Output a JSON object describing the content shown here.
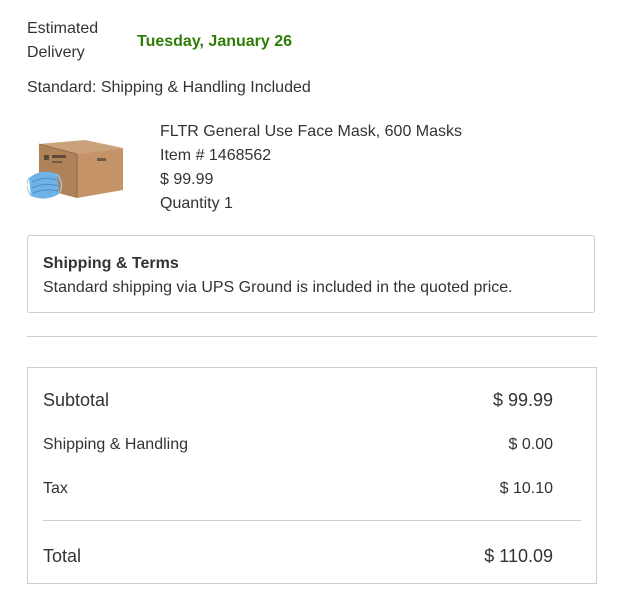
{
  "delivery": {
    "label": "Estimated Delivery",
    "date": "Tuesday, January 26",
    "date_color": "#2f7d06"
  },
  "shipping_method": "Standard: Shipping & Handling Included",
  "product": {
    "image_icon": "face-mask-box-icon",
    "name": "FLTR General Use Face Mask, 600 Masks",
    "item_number": "Item # 1468562",
    "price": "$ 99.99",
    "quantity": "Quantity 1"
  },
  "terms": {
    "title": "Shipping & Terms",
    "text": "Standard shipping via UPS Ground is included in the quoted price."
  },
  "summary": {
    "subtotal_label": "Subtotal",
    "subtotal_value": "$ 99.99",
    "shipping_label": "Shipping & Handling",
    "shipping_value": "$ 0.00",
    "tax_label": "Tax",
    "tax_value": "$ 10.10",
    "total_label": "Total",
    "total_value": "$ 110.09"
  }
}
